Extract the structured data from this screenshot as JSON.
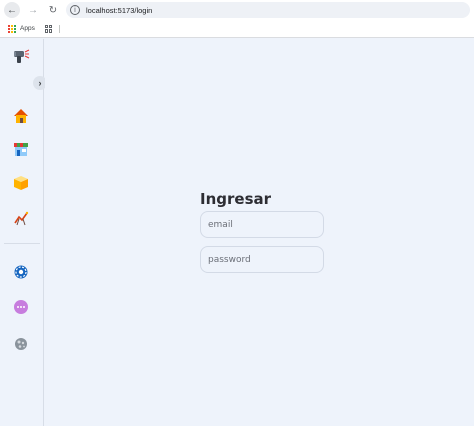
{
  "browser": {
    "url": "localhost:5173/login",
    "bookmarks": {
      "apps_label": "Apps"
    }
  },
  "sidebar": {
    "items": [
      {
        "icon": "barcode-scanner-icon"
      },
      {
        "icon": "house-icon"
      },
      {
        "icon": "store-icon"
      },
      {
        "icon": "box-icon"
      },
      {
        "icon": "chart-icon"
      },
      {
        "icon": "gear-icon"
      },
      {
        "icon": "more-icon"
      },
      {
        "icon": "globe-icon"
      }
    ],
    "collapse_icon": "chevron-right-icon"
  },
  "login": {
    "title": "Ingresar",
    "email_placeholder": "email",
    "password_placeholder": "password"
  }
}
